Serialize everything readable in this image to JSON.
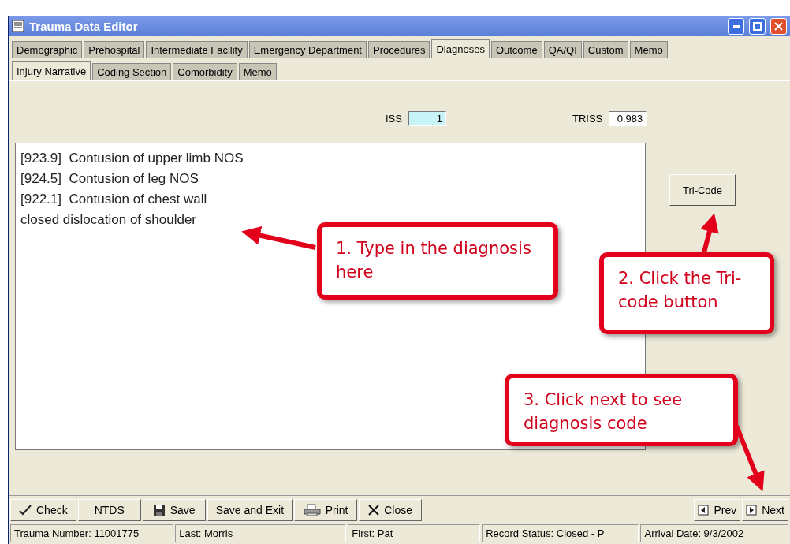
{
  "window": {
    "title": "Trauma Data Editor"
  },
  "tabs": [
    {
      "label": "Demographic",
      "selected": false
    },
    {
      "label": "Prehospital",
      "selected": false
    },
    {
      "label": "Intermediate Facility",
      "selected": false
    },
    {
      "label": "Emergency Department",
      "selected": false
    },
    {
      "label": "Procedures",
      "selected": false
    },
    {
      "label": "Diagnoses",
      "selected": true
    },
    {
      "label": "Outcome",
      "selected": false
    },
    {
      "label": "QA/QI",
      "selected": false
    },
    {
      "label": "Custom",
      "selected": false
    },
    {
      "label": "Memo",
      "selected": false
    }
  ],
  "subtabs": [
    {
      "label": "Injury Narrative",
      "selected": true
    },
    {
      "label": "Coding Section",
      "selected": false
    },
    {
      "label": "Comorbidity",
      "selected": false
    },
    {
      "label": "Memo",
      "selected": false
    }
  ],
  "scores": [
    {
      "label": "ISS",
      "value": "1",
      "kind": "computed"
    },
    {
      "label": "TRISS",
      "value": "0.983",
      "kind": "plain"
    }
  ],
  "narrative": {
    "lines": [
      "[923.9]  Contusion of upper limb NOS",
      "[924.5]  Contusion of leg NOS",
      "[922.1]  Contusion of chest wall",
      "closed dislocation of shoulder"
    ]
  },
  "tricode_button": "Tri-Code",
  "toolbar": [
    {
      "label": "Check",
      "kind": "check"
    },
    {
      "label": "NTDS",
      "kind": "none"
    },
    {
      "label": "Save",
      "kind": "save"
    },
    {
      "label": "Save and Exit",
      "kind": "none"
    },
    {
      "label": "Print",
      "kind": "print"
    },
    {
      "label": "Close",
      "kind": "close"
    }
  ],
  "nav": [
    {
      "label": "Prev",
      "kind": "prev"
    },
    {
      "label": "Next",
      "kind": "next"
    }
  ],
  "status_bar": [
    "Trauma Number: 11001775",
    "Last: Morris",
    "First: Pat",
    "Record Status: Closed - P",
    "Arrival Date: 9/3/2002"
  ],
  "callouts": [
    {
      "text": "1. Type in the diagnosis here"
    },
    {
      "text": "2. Click the Tri-code button"
    },
    {
      "text": "3. Click next to see diagnosis code"
    }
  ]
}
